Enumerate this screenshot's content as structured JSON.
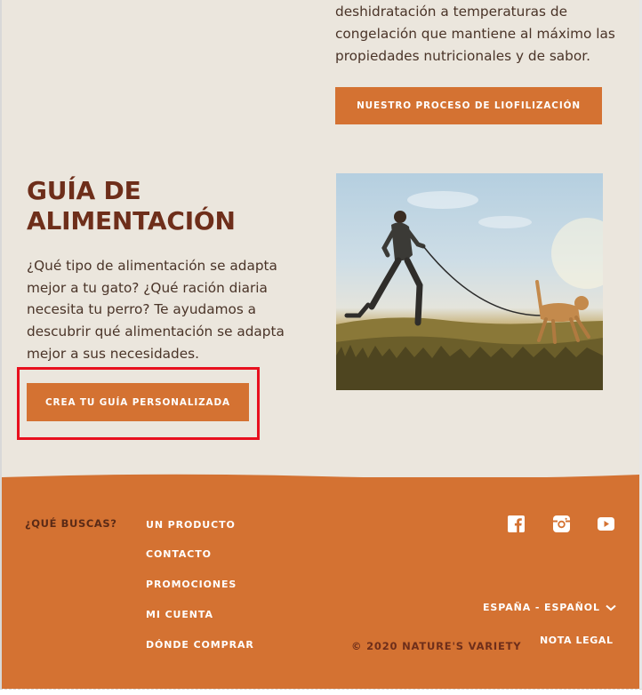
{
  "liofilizacion": {
    "text_lines": [
      "deshidratación a temperaturas de",
      "congelación que mantiene al máximo las",
      "propiedades nutricionales y de sabor."
    ],
    "button_label": "NUESTRO PROCESO DE LIOFILIZACIÓN"
  },
  "guia": {
    "title_line1": "GUÍA DE",
    "title_line2": "ALIMENTACIÓN",
    "text": "¿Qué tipo de alimentación se adapta mejor a tu gato? ¿Qué ración diaria necesita tu perro? Te ayudamos a descubrir qué alimentación se adapta mejor a sus necesidades.",
    "button_label": "CREA TU GUÍA PERSONALIZADA"
  },
  "footer": {
    "label": "¿QUÉ BUSCAS?",
    "links": [
      "UN PRODUCTO",
      "CONTACTO",
      "PROMOCIONES",
      "MI CUENTA",
      "DÓNDE COMPRAR"
    ],
    "language": "ESPAÑA - ESPAÑOL",
    "legal": "NOTA LEGAL",
    "copyright": "© 2020 NATURE'S VARIETY",
    "social_icons": [
      "facebook-icon",
      "instagram-icon",
      "youtube-icon"
    ]
  },
  "colors": {
    "accent": "#d47232",
    "heading": "#6e2e1a",
    "background": "#ebe6dd",
    "highlight": "#e8101e"
  }
}
